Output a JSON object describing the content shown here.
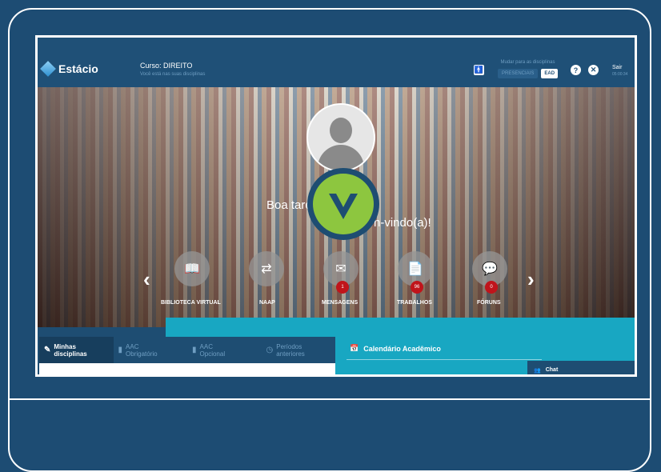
{
  "brand": {
    "logo_text": "Estácio"
  },
  "header": {
    "course_title": "Curso: DIREITO",
    "course_subtitle": "Você está nas suas disciplinas",
    "mode_label": "Mudar para as disciplinas",
    "mode_presencial": "PRESENCIAIS",
    "mode_ead": "EAD",
    "exit_label": "Sair",
    "exit_timer": "05:00:34"
  },
  "hero": {
    "greeting": "Boa tard",
    "welcome": "n-vindo(a)!",
    "items": [
      {
        "label": "BIBLIOTECA VIRTUAL",
        "icon": "book-icon",
        "badge": ""
      },
      {
        "label": "NAAP",
        "icon": "exchange-icon",
        "badge": ""
      },
      {
        "label": "MENSAGENS",
        "icon": "envelope-icon",
        "badge": "1"
      },
      {
        "label": "TRABALHOS",
        "icon": "document-icon",
        "badge": "96"
      },
      {
        "label": "FÓRUNS",
        "icon": "chat-bubbles-icon",
        "badge": "0"
      }
    ]
  },
  "tabs": [
    {
      "label_line1": "Minhas",
      "label_line2": "disciplinas"
    },
    {
      "label_line1": "AAC",
      "label_line2": "Obrigatório"
    },
    {
      "label_line1": "AAC",
      "label_line2": "Opcional"
    },
    {
      "label_line1": "Períodos",
      "label_line2": "anteriores"
    }
  ],
  "calendar": {
    "title": "Calendário Acadêmico"
  },
  "chat": {
    "label": "Chat"
  },
  "colors": {
    "frame_bg": "#1d4c73",
    "accent_teal": "#18a7c2",
    "badge_red": "#c0141b",
    "check_green": "#8dc63f"
  }
}
